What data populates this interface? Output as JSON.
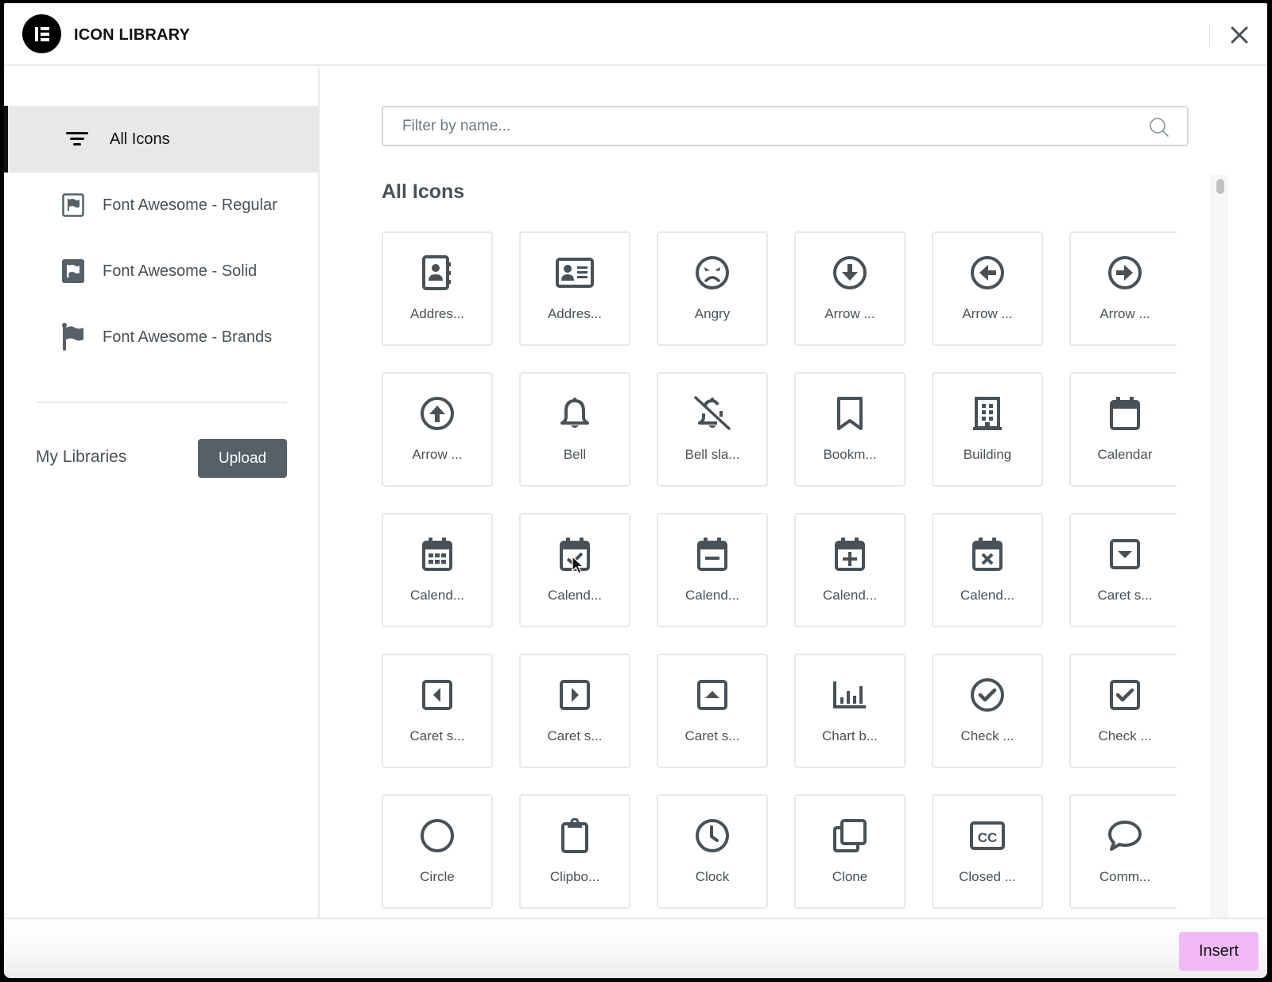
{
  "header": {
    "title": "ICON LIBRARY",
    "logo": "elementor-logo",
    "close_icon": "close-icon"
  },
  "sidebar": {
    "items": [
      {
        "label": "All Icons",
        "icon": "filter-lines-icon",
        "active": true
      },
      {
        "label": "Font Awesome - Regular",
        "icon": "flag-regular-icon",
        "active": false
      },
      {
        "label": "Font Awesome - Solid",
        "icon": "flag-solid-icon",
        "active": false
      },
      {
        "label": "Font Awesome - Brands",
        "icon": "flag-brands-icon",
        "active": false
      }
    ],
    "my_libraries_label": "My Libraries",
    "upload_label": "Upload"
  },
  "main": {
    "search": {
      "placeholder": "Filter by name...",
      "value": ""
    },
    "section_title": "All Icons",
    "icons": [
      {
        "label": "Addres...",
        "icon": "address-book-icon"
      },
      {
        "label": "Addres...",
        "icon": "address-card-icon"
      },
      {
        "label": "Angry",
        "icon": "angry-face-icon"
      },
      {
        "label": "Arrow ...",
        "icon": "arrow-circle-down-icon"
      },
      {
        "label": "Arrow ...",
        "icon": "arrow-circle-left-icon"
      },
      {
        "label": "Arrow ...",
        "icon": "arrow-circle-right-icon"
      },
      {
        "label": "Arrow ...",
        "icon": "arrow-circle-up-icon"
      },
      {
        "label": "Bell",
        "icon": "bell-icon"
      },
      {
        "label": "Bell sla...",
        "icon": "bell-slash-icon"
      },
      {
        "label": "Bookm...",
        "icon": "bookmark-icon"
      },
      {
        "label": "Building",
        "icon": "building-icon"
      },
      {
        "label": "Calendar",
        "icon": "calendar-icon"
      },
      {
        "label": "Calend...",
        "icon": "calendar-alt-icon"
      },
      {
        "label": "Calend...",
        "icon": "calendar-check-icon"
      },
      {
        "label": "Calend...",
        "icon": "calendar-minus-icon"
      },
      {
        "label": "Calend...",
        "icon": "calendar-plus-icon"
      },
      {
        "label": "Calend...",
        "icon": "calendar-times-icon"
      },
      {
        "label": "Caret s...",
        "icon": "caret-square-down-icon"
      },
      {
        "label": "Caret s...",
        "icon": "caret-square-left-icon"
      },
      {
        "label": "Caret s...",
        "icon": "caret-square-right-icon"
      },
      {
        "label": "Caret s...",
        "icon": "caret-square-up-icon"
      },
      {
        "label": "Chart b...",
        "icon": "chart-bar-icon"
      },
      {
        "label": "Check ...",
        "icon": "check-circle-icon"
      },
      {
        "label": "Check ...",
        "icon": "check-square-icon"
      },
      {
        "label": "Circle",
        "icon": "circle-icon"
      },
      {
        "label": "Clipbo...",
        "icon": "clipboard-icon"
      },
      {
        "label": "Clock",
        "icon": "clock-icon"
      },
      {
        "label": "Clone",
        "icon": "clone-icon"
      },
      {
        "label": "Closed ...",
        "icon": "closed-captioning-icon"
      },
      {
        "label": "Comm...",
        "icon": "comment-icon"
      }
    ]
  },
  "footer": {
    "insert_label": "Insert"
  },
  "colors": {
    "insert_bg": "#f1baf6",
    "upload_bg": "#556068",
    "icon_color": "#495157",
    "active_bg": "#e6e8ea"
  }
}
